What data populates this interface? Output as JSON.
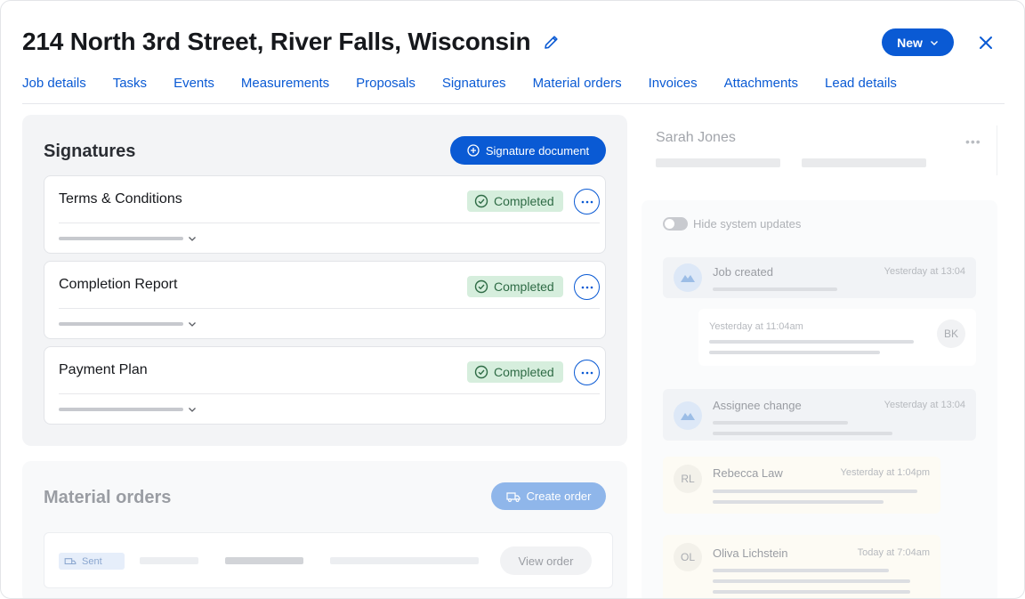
{
  "header": {
    "title": "214 North 3rd Street, River Falls, Wisconsin",
    "new_button": "New",
    "icons": {
      "edit": "pencil-icon",
      "close": "close-icon",
      "dropdown": "chevron-down-icon"
    }
  },
  "tabs": [
    {
      "label": "Job details"
    },
    {
      "label": "Tasks"
    },
    {
      "label": "Events"
    },
    {
      "label": "Measurements"
    },
    {
      "label": "Proposals"
    },
    {
      "label": "Signatures"
    },
    {
      "label": "Material orders"
    },
    {
      "label": "Invoices"
    },
    {
      "label": "Attachments"
    },
    {
      "label": "Lead details"
    }
  ],
  "signatures": {
    "title": "Signatures",
    "add_button": "Signature document",
    "items": [
      {
        "title": "Terms & Conditions",
        "status": "Completed"
      },
      {
        "title": "Completion Report",
        "status": "Completed"
      },
      {
        "title": "Payment Plan",
        "status": "Completed"
      }
    ]
  },
  "material_orders": {
    "title": "Material orders",
    "create_button": "Create order",
    "order": {
      "status": "Sent",
      "view_button": "View order"
    }
  },
  "contact": {
    "name": "Sarah Jones"
  },
  "activity": {
    "toggle_label": "Hide system updates",
    "events": [
      {
        "title": "Job created",
        "time": "Yesterday at 13:04"
      },
      {
        "title": "",
        "time": "Yesterday at 11:04am",
        "initials": "BK"
      },
      {
        "title": "Assignee change",
        "time": "Yesterday at 13:04"
      },
      {
        "title": "Rebecca Law",
        "time": "Yesterday at 1:04pm",
        "initials": "RL"
      },
      {
        "title": "Oliva Lichstein",
        "time": "Today at 7:04am",
        "initials": "OL"
      }
    ]
  },
  "colors": {
    "accent": "#0a5ad4",
    "completed_bg": "#d6eedd",
    "completed_text": "#2e6b45"
  }
}
